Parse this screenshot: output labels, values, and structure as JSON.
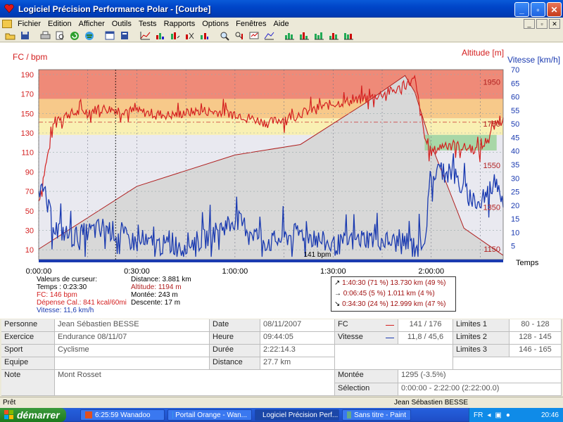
{
  "window": {
    "title": "Logiciel Précision Performance Polar - [Courbe]"
  },
  "menu": [
    "Fichier",
    "Edition",
    "Afficher",
    "Outils",
    "Tests",
    "Rapports",
    "Options",
    "Fenêtres",
    "Aide"
  ],
  "chart": {
    "left_axis_title": "FC / bpm",
    "altitude_title": "Altitude [m]",
    "right_axis_title": "Vitesse [km/h]",
    "hr_ticks": [
      "190",
      "170",
      "150",
      "130",
      "110",
      "90",
      "70",
      "50",
      "30",
      "10"
    ],
    "speed_ticks": [
      "70",
      "65",
      "60",
      "55",
      "50",
      "45",
      "40",
      "35",
      "30",
      "25",
      "20",
      "15",
      "10",
      "5"
    ],
    "alt_ticks": [
      "1950",
      "1750",
      "1550",
      "1350",
      "1150"
    ],
    "time_ticks": [
      "0:00:00",
      "0:30:00",
      "1:00:00",
      "1:30:00",
      "2:00:00"
    ],
    "time_label": "Temps",
    "cursor_label": "141 bpm",
    "colors": {
      "zone_red": "#ef8a78",
      "zone_orange": "#f7c98a",
      "zone_yellow": "#f9f0b3",
      "zone_green": "#9cd49a",
      "hr_line": "#d42020",
      "speed_line": "#1a3ab0",
      "altitude_fill": "#d8d8d8",
      "altitude_line": "#b02020"
    }
  },
  "chart_data": {
    "type": "line",
    "xlabel": "Temps",
    "x_range": [
      "0:00:00",
      "2:22:00"
    ],
    "series": [
      {
        "name": "FC",
        "axis": "left",
        "unit": "bpm",
        "ylim": [
          0,
          195
        ],
        "x_min": [
          0,
          5,
          10,
          20,
          30,
          40,
          50,
          60,
          70,
          80,
          90,
          100,
          110,
          115,
          118,
          120,
          125,
          130,
          135,
          140,
          142
        ],
        "values": [
          60,
          145,
          150,
          155,
          152,
          148,
          153,
          150,
          140,
          150,
          160,
          165,
          175,
          185,
          125,
          110,
          120,
          115,
          112,
          140,
          150
        ]
      },
      {
        "name": "Vitesse",
        "axis": "right",
        "unit": "km/h",
        "ylim": [
          0,
          70
        ],
        "x_min": [
          0,
          5,
          10,
          20,
          30,
          40,
          50,
          60,
          70,
          80,
          90,
          100,
          110,
          115,
          118,
          120,
          125,
          130,
          135,
          140,
          142
        ],
        "values": [
          28,
          12,
          8,
          12,
          6,
          5,
          7,
          15,
          6,
          10,
          5,
          8,
          6,
          5,
          8,
          30,
          35,
          25,
          20,
          30,
          22
        ]
      },
      {
        "name": "Altitude",
        "axis": "right-inner",
        "unit": "m",
        "x_min": [
          0,
          10,
          30,
          60,
          80,
          100,
          112,
          115,
          120,
          130,
          142
        ],
        "values": [
          1150,
          1250,
          1450,
          1600,
          1650,
          1850,
          1980,
          1900,
          1650,
          1250,
          1120
        ]
      }
    ]
  },
  "cursor_values": {
    "heading": "Valeurs de curseur:",
    "time": "Temps : 0:23:30",
    "fc": "FC: 146 bpm",
    "energy": "Dépense Cal.: 841 kcal/60mi",
    "speed": "Vitesse: 11,6 km/h",
    "distance": "Distance: 3.881 km",
    "altitude": "Altitude: 1194 m",
    "ascent": "Montée: 243 m",
    "descent": "Descente: 17 m"
  },
  "zone_stats": [
    {
      "arrow": "↗",
      "text": "1:40:30  (71 %) 13.730 km  (49 %)"
    },
    {
      "arrow": "→",
      "text": "0:06:45   (5 %)   1.011 km   (4 %)"
    },
    {
      "arrow": "↘",
      "text": "0:34:30  (24 %) 12.999 km  (47 %)"
    }
  ],
  "summary": {
    "personne_label": "Personne",
    "personne": "Jean Sébastien BESSE",
    "exercice_label": "Exercice",
    "exercice": "Endurance  08/11/07",
    "sport_label": "Sport",
    "sport": "Cyclisme",
    "equipe_label": "Equipe",
    "equipe": "",
    "note_label": "Note",
    "note": "Mont Rosset",
    "date_label": "Date",
    "date": "08/11/2007",
    "heure_label": "Heure",
    "heure": "09:44:05",
    "duree_label": "Durée",
    "duree": "2:22:14.3",
    "distance_label": "Distance",
    "distance": "27.7 km",
    "fc_label": "FC",
    "fc": "141 / 176",
    "vitesse_label": "Vitesse",
    "vitesse": "11,8 / 45,6",
    "limite1_label": "Limites 1",
    "limite1": "80 - 128",
    "limite2_label": "Limites 2",
    "limite2": "128 - 145",
    "limite3_label": "Limites 3",
    "limite3": "146 - 165",
    "montee_label": "Montée",
    "montee": "1295 (-3.5%)",
    "selection_label": "Sélection",
    "selection": "0:00:00 - 2:22:00 (2:22:00.0)"
  },
  "statusbar": {
    "left": "Prêt",
    "right": "Jean Sébastien BESSE"
  },
  "taskbar": {
    "start": "démarrer",
    "tasks": [
      "6:25:59 Wanadoo",
      "Portail Orange - Wan...",
      "Logiciel Précision Perf...",
      "Sans titre - Paint"
    ],
    "lang": "FR",
    "clock": "20:46"
  }
}
